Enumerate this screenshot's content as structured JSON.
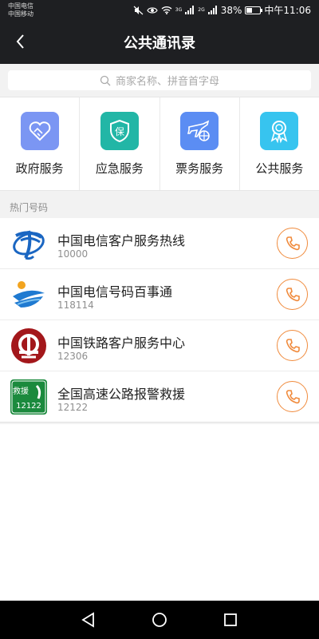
{
  "status": {
    "carrier1": "中国电信",
    "carrier2": "中国移动",
    "battery": "38%",
    "time": "中午11:06",
    "net1": "3G",
    "net2": "2G"
  },
  "header": {
    "title": "公共通讯录",
    "back_icon": "chevron-left-icon"
  },
  "search": {
    "placeholder": "商家名称、拼音首字母"
  },
  "categories": [
    {
      "label": "政府服务",
      "icon": "handshake-heart-icon",
      "color": "#7b96f3"
    },
    {
      "label": "应急服务",
      "icon": "shield-bao-icon",
      "color": "#22b6a6"
    },
    {
      "label": "票务服务",
      "icon": "airplane-globe-icon",
      "color": "#5b8df3"
    },
    {
      "label": "公共服务",
      "icon": "award-ribbon-icon",
      "color": "#37c4ef"
    }
  ],
  "hot": {
    "title": "热门号码",
    "items": [
      {
        "name": "中国电信客户服务热线",
        "number": "10000"
      },
      {
        "name": "中国电信号码百事通",
        "number": "118114"
      },
      {
        "name": "中国铁路客户服务中心",
        "number": "12306"
      },
      {
        "name": "全国高速公路报警救援",
        "number": "12122"
      }
    ]
  },
  "logo_text": {
    "rescue_top": "救援",
    "rescue_bottom": "12122"
  },
  "colors": {
    "accent": "#f08b3d",
    "header_bg": "#1e1f22"
  }
}
